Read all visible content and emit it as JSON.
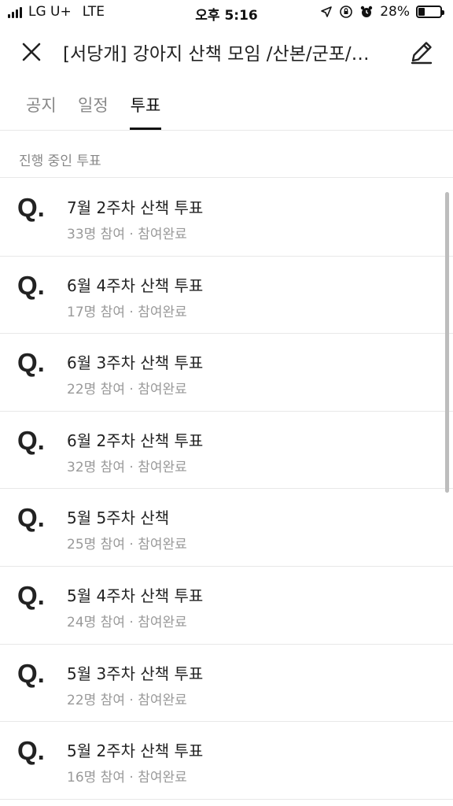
{
  "status_bar": {
    "carrier": "LG U+",
    "network": "LTE",
    "time": "오후 5:16",
    "battery": "28%",
    "battery_level": 0.28
  },
  "header": {
    "title": "[서당개] 강아지 산책 모임 /산본/군포/…",
    "close_icon": "close-icon",
    "edit_icon": "pencil-icon"
  },
  "tabs": [
    {
      "label": "공지",
      "active": false
    },
    {
      "label": "일정",
      "active": false
    },
    {
      "label": "투표",
      "active": true
    }
  ],
  "section": {
    "label": "진행 중인 투표"
  },
  "polls": [
    {
      "icon": "Q.",
      "title": "7월 2주차 산책 투표",
      "participants": "33명 참여",
      "status": "참여완료"
    },
    {
      "icon": "Q.",
      "title": "6월 4주차 산책 투표",
      "participants": "17명 참여",
      "status": "참여완료"
    },
    {
      "icon": "Q.",
      "title": "6월 3주차 산책 투표",
      "participants": "22명 참여",
      "status": "참여완료"
    },
    {
      "icon": "Q.",
      "title": "6월 2주차 산책 투표",
      "participants": "32명 참여",
      "status": "참여완료"
    },
    {
      "icon": "Q.",
      "title": "5월 5주차 산책",
      "participants": "25명 참여",
      "status": "참여완료"
    },
    {
      "icon": "Q.",
      "title": "5월 4주차 산책 투표",
      "participants": "24명 참여",
      "status": "참여완료"
    },
    {
      "icon": "Q.",
      "title": "5월 3주차 산책 투표",
      "participants": "22명 참여",
      "status": "참여완료"
    },
    {
      "icon": "Q.",
      "title": "5월 2주차 산책 투표",
      "participants": "16명 참여",
      "status": "참여완료"
    }
  ],
  "separator": " · "
}
